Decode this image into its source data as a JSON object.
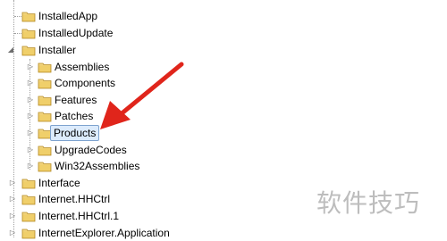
{
  "tree": {
    "rows": [
      {
        "label": "InstalledApp"
      },
      {
        "label": "InstalledUpdate"
      },
      {
        "label": "Installer"
      },
      {
        "label": "Assemblies"
      },
      {
        "label": "Components"
      },
      {
        "label": "Features"
      },
      {
        "label": "Patches"
      },
      {
        "label": "Products"
      },
      {
        "label": "UpgradeCodes"
      },
      {
        "label": "Win32Assemblies"
      },
      {
        "label": "Interface"
      },
      {
        "label": "Internet.HHCtrl"
      },
      {
        "label": "Internet.HHCtrl.1"
      },
      {
        "label": "InternetExplorer.Application"
      }
    ]
  },
  "watermark": "软件技巧",
  "colors": {
    "selection_bg": "#dcebfc",
    "selection_border": "#7da2ce",
    "folder": "#e8c45f",
    "arrow": "#e0251b"
  },
  "icons": {
    "folder": "folder-icon",
    "collapsed": "expand-triangle-icon",
    "expanded": "collapse-triangle-icon"
  }
}
